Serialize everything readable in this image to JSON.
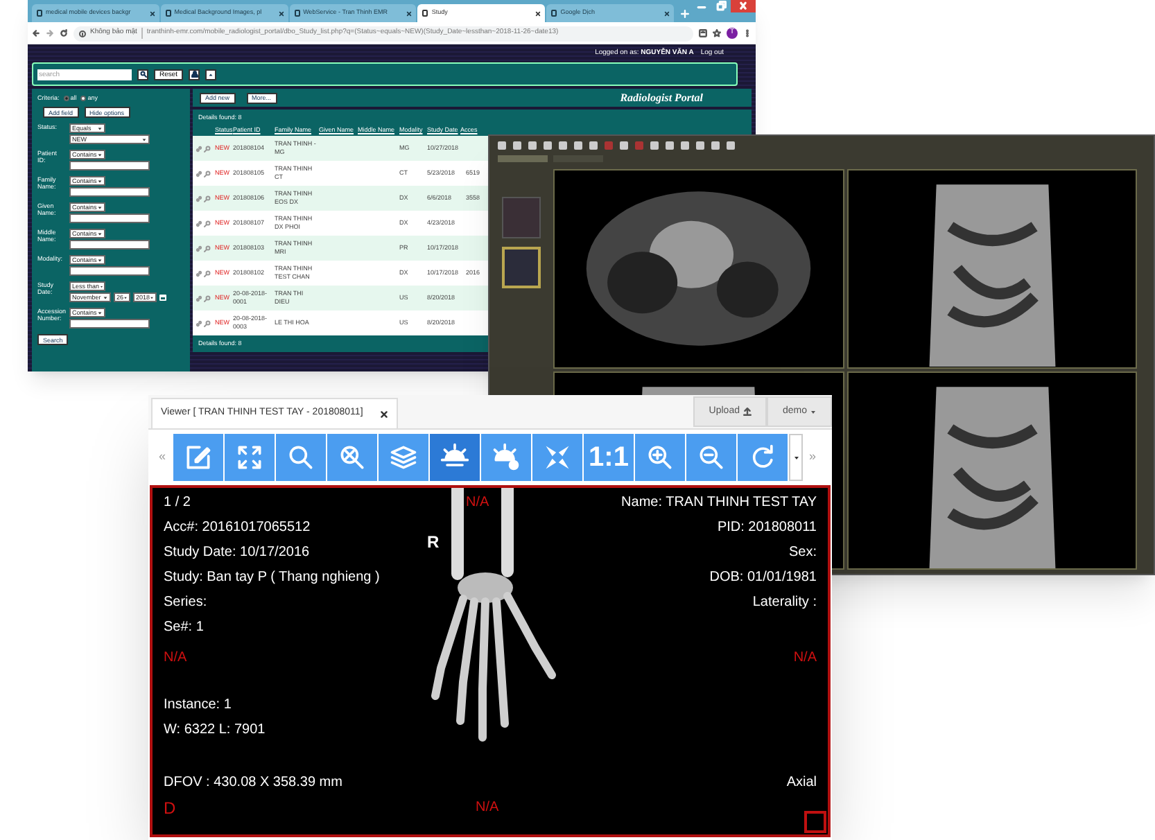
{
  "browser": {
    "tabs": [
      {
        "label": "medical mobile devices backgr",
        "selected": false
      },
      {
        "label": "Medical Background Images, pl",
        "selected": false
      },
      {
        "label": "WebService - Tran Thinh EMR",
        "selected": false
      },
      {
        "label": "Study",
        "selected": true
      },
      {
        "label": "Google Dịch",
        "selected": false
      }
    ],
    "address": {
      "security": "Không bảo mật",
      "url": "tranthinh-emr.com/mobile_radiologist_portal/dbo_Study_list.php?q=(Status~equals~NEW)(Study_Date~lessthan~2018-11-26~date13)"
    },
    "profile": "T"
  },
  "portal": {
    "logged_label": "Logged on as:",
    "user": "NGUYỄN VĂN A",
    "logout": "Log out",
    "search": {
      "placeholder": "search"
    },
    "reset": "Reset",
    "criteria": {
      "label": "Criteria:",
      "options": [
        {
          "label": "all",
          "selected": true
        },
        {
          "label": "any",
          "selected": false
        }
      ]
    },
    "option_buttons": [
      "Add field",
      "Hide options"
    ],
    "filters": [
      {
        "kind": "select",
        "label": "Status:",
        "operator": "Equals",
        "value": "NEW"
      },
      {
        "kind": "text",
        "label": "Patient ID:",
        "operator": "Contains"
      },
      {
        "kind": "text",
        "label": "Family Name:",
        "operator": "Contains"
      },
      {
        "kind": "text",
        "label": "Given Name:",
        "operator": "Contains"
      },
      {
        "kind": "text",
        "label": "Middle Name:",
        "operator": "Contains"
      },
      {
        "kind": "text",
        "label": "Modality:",
        "operator": "Contains"
      },
      {
        "kind": "date",
        "label": "Study Date:",
        "operator": "Less than",
        "month": "November",
        "day": "26",
        "year": "2018"
      },
      {
        "kind": "text",
        "label": "Accession Number:",
        "operator": "Contains"
      }
    ],
    "search_button": "Search",
    "actions": [
      "Add new",
      "More..."
    ],
    "brand": "Radiologist Portal",
    "details_top": "Details found: 8",
    "details_bottom": "Details found: 8",
    "table": {
      "columns": [
        "Status",
        "Patient ID",
        "Family Name",
        "Given Name",
        "Middle Name",
        "Modality",
        "Study Date",
        "Acces"
      ],
      "rows": [
        {
          "status": "NEW",
          "patient_id": "201808104",
          "family_name": "TRAN THINH - MG",
          "modality": "MG",
          "study_date": "10/27/2018"
        },
        {
          "status": "NEW",
          "patient_id": "201808105",
          "family_name": "TRAN THINH CT",
          "modality": "CT",
          "study_date": "5/23/2018",
          "column_8": "6519"
        },
        {
          "status": "NEW",
          "patient_id": "201808106",
          "family_name": "TRAN THINH EOS DX",
          "modality": "DX",
          "study_date": "6/6/2018",
          "column_8": "3558"
        },
        {
          "status": "NEW",
          "patient_id": "201808107",
          "family_name": "TRAN THINH DX PHOI",
          "modality": "DX",
          "study_date": "4/23/2018"
        },
        {
          "status": "NEW",
          "patient_id": "201808103",
          "family_name": "TRAN THINH MRI",
          "modality": "PR",
          "study_date": "10/17/2018"
        },
        {
          "status": "NEW",
          "patient_id": "201808102",
          "family_name": "TRAN THINH TEST CHAN",
          "modality": "DX",
          "study_date": "10/17/2018",
          "column_8": "2016"
        },
        {
          "status": "NEW",
          "patient_id": "20-08-2018-0001",
          "family_name": "TRAN THI DIEU",
          "modality": "US",
          "study_date": "8/20/2018"
        },
        {
          "status": "NEW",
          "patient_id": "20-08-2018-0003",
          "family_name": "LE THI HOA",
          "modality": "US",
          "study_date": "8/20/2018"
        }
      ]
    }
  },
  "viewer": {
    "tab": "Viewer [ TRAN THINH TEST TAY - 201808011]",
    "upload": "Upload",
    "user": "demo",
    "prev": "«",
    "next": "»",
    "toolbar": [
      {
        "selected": false
      },
      {
        "selected": false
      },
      {
        "selected": false
      },
      {
        "selected": false
      },
      {
        "selected": false
      },
      {
        "selected": true
      },
      {
        "selected": false
      },
      {
        "selected": false
      },
      {
        "label": "1:1",
        "selected": false
      },
      {
        "selected": false
      },
      {
        "selected": false
      },
      {
        "selected": false
      }
    ],
    "overlay": {
      "top_left": [
        "1 / 2",
        "Acc#: 20161017065512",
        "Study Date: 10/17/2016",
        "Study: Ban tay P ( Thang nghieng )",
        "Series:",
        "Se#: 1"
      ],
      "left_marker": "N/A",
      "bottom_left": [
        "Instance: 1",
        "W: 6322 L: 7901"
      ],
      "dfov": "DFOV : 430.08 X 358.39 mm",
      "bottom_left_marker": "D",
      "top_right": [
        "Name: TRAN THINH TEST TAY",
        "PID: 201808011",
        "Sex:",
        "DOB: 01/01/1981",
        "Laterality :"
      ],
      "right_marker": "N/A",
      "bottom_right": "Axial",
      "top_marker": "N/A",
      "bottom_marker": "N/A",
      "orientation": "R"
    }
  }
}
